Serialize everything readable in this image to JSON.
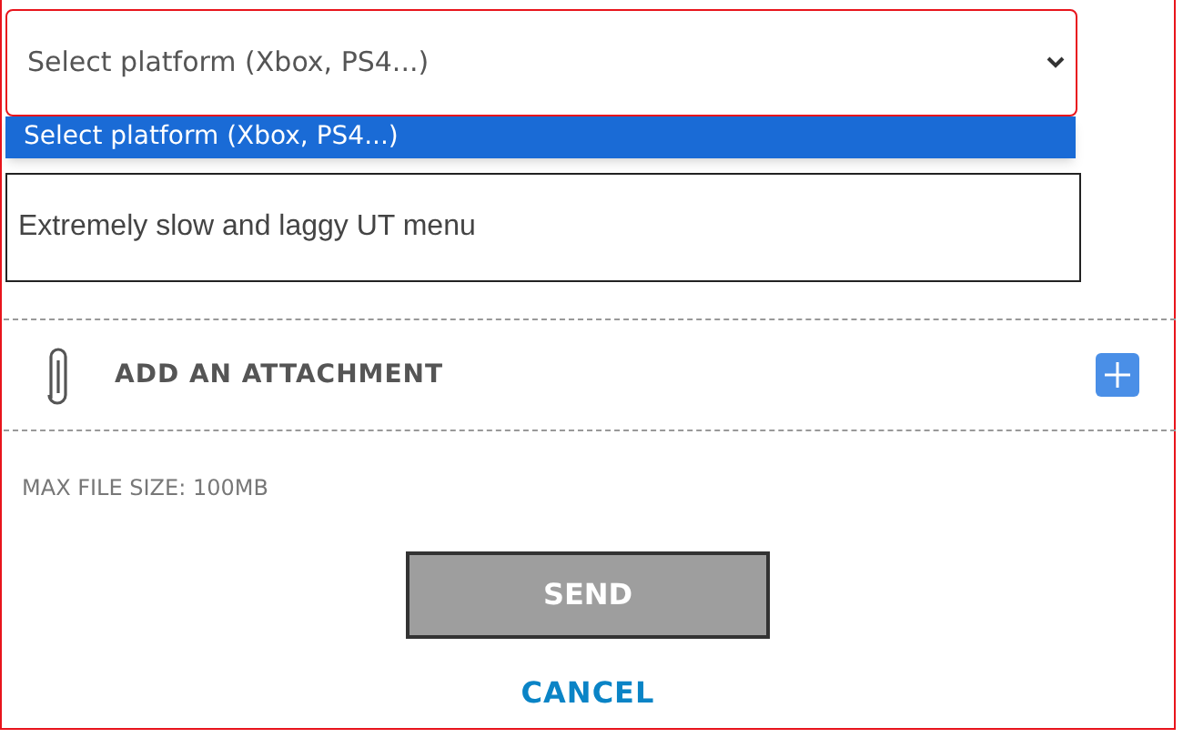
{
  "platform_select": {
    "value": "Select platform (Xbox, PS4...)",
    "expanded": true,
    "options": [
      {
        "label": "Select platform (Xbox, PS4...)",
        "selected": true
      }
    ]
  },
  "description_field": {
    "value": "Extremely slow and laggy UT menu"
  },
  "attachment": {
    "label": "ADD AN ATTACHMENT"
  },
  "max_file_size": "MAX FILE SIZE: 100MB",
  "buttons": {
    "send": "SEND",
    "cancel": "CANCEL"
  }
}
